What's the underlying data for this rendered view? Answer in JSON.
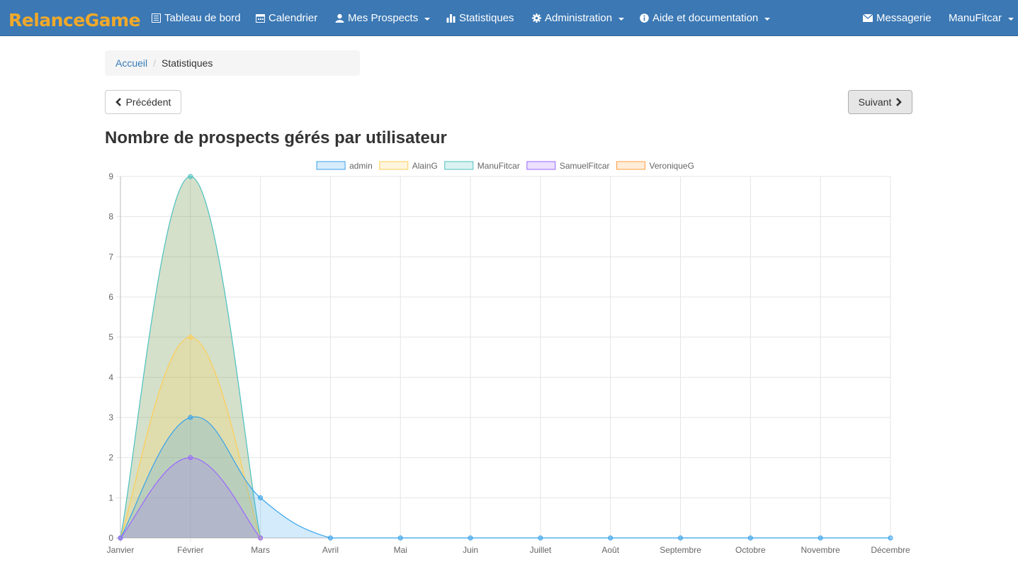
{
  "navbar": {
    "brand": "RelanceGame",
    "items": [
      {
        "label": "Tableau de bord",
        "icon": "dashboard-icon"
      },
      {
        "label": "Calendrier",
        "icon": "calendar-icon"
      },
      {
        "label": "Mes Prospects",
        "icon": "user-icon",
        "dropdown": true
      },
      {
        "label": "Statistiques",
        "icon": "bar-chart-icon"
      },
      {
        "label": "Administration",
        "icon": "gear-icon",
        "dropdown": true
      },
      {
        "label": "Aide et documentation",
        "icon": "info-icon",
        "dropdown": true
      }
    ],
    "right": [
      {
        "label": "Messagerie",
        "icon": "envelope-icon"
      },
      {
        "label": "ManuFitcar",
        "dropdown": true
      }
    ]
  },
  "breadcrumb": {
    "home": "Accueil",
    "current": "Statistiques"
  },
  "buttons": {
    "previous": "Précédent",
    "next": "Suivant"
  },
  "page": {
    "title": "Nombre de prospects gérés par utilisateur"
  },
  "chart_data": {
    "type": "area",
    "title": "",
    "categories": [
      "Janvier",
      "Février",
      "Mars",
      "Avril",
      "Mai",
      "Juin",
      "Juillet",
      "Août",
      "Septembre",
      "Octobre",
      "Novembre",
      "Décembre"
    ],
    "ylim": [
      0,
      9
    ],
    "yticks": [
      0,
      1,
      2,
      3,
      4,
      5,
      6,
      7,
      8,
      9
    ],
    "grid": true,
    "legend": "top",
    "series": [
      {
        "name": "admin",
        "values": [
          0,
          3,
          1,
          0,
          0,
          0,
          0,
          0,
          0,
          0,
          0,
          0
        ],
        "color": "#36a2eb"
      },
      {
        "name": "AlainG",
        "values": [
          0,
          5,
          0
        ],
        "color": "#ffce56"
      },
      {
        "name": "ManuFitcar",
        "values": [
          0,
          9,
          0
        ],
        "color": "#4bc0c0"
      },
      {
        "name": "SamuelFitcar",
        "values": [
          0,
          2,
          0
        ],
        "color": "#9966ff"
      },
      {
        "name": "VeroniqueG",
        "values": [],
        "color": "#ff9f40"
      }
    ]
  }
}
